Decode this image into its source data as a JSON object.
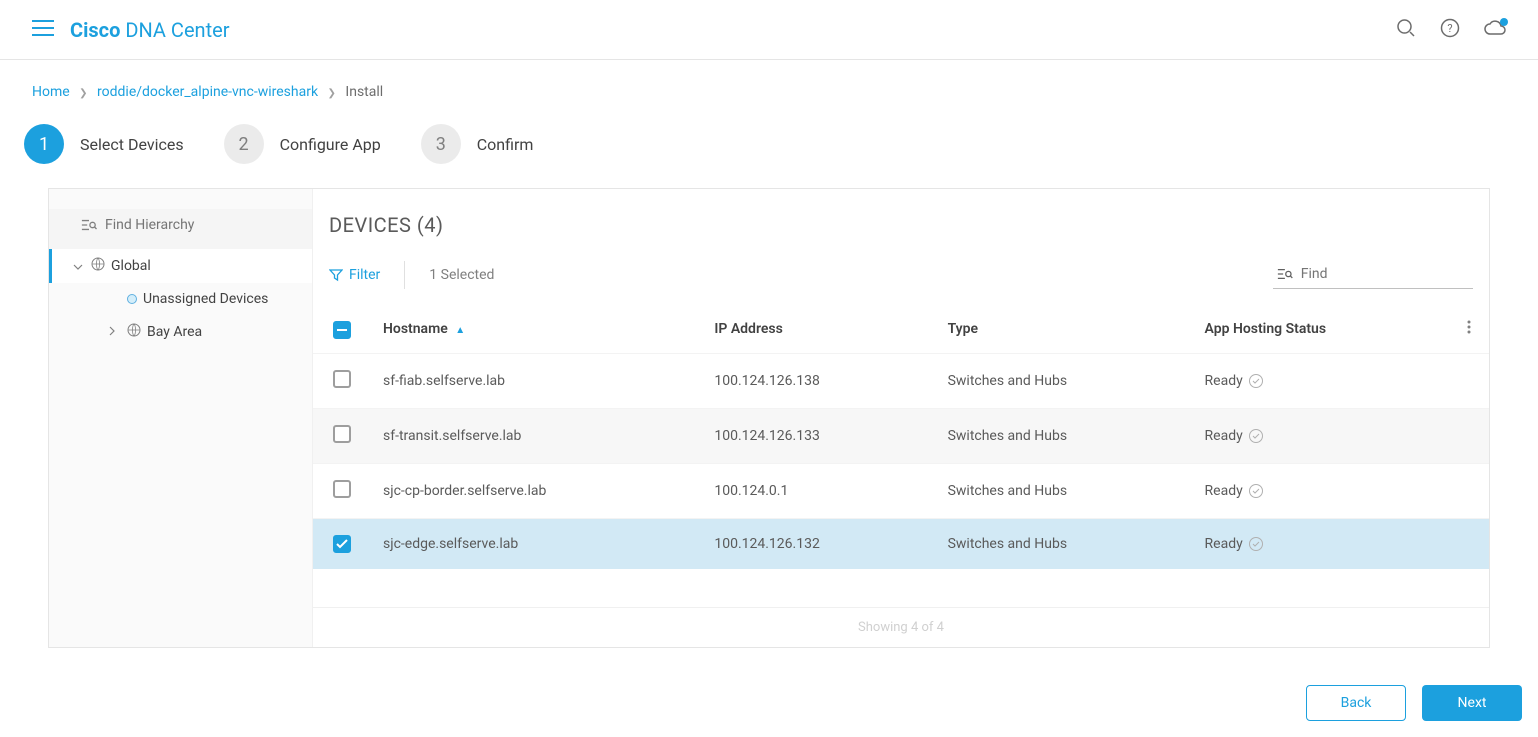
{
  "brand": {
    "cisco": "Cisco",
    "dna": "DNA Center"
  },
  "breadcrumb": {
    "home": "Home",
    "mid": "roddie/docker_alpine-vnc-wireshark",
    "current": "Install"
  },
  "stepper": {
    "s1": {
      "num": "1",
      "label": "Select Devices"
    },
    "s2": {
      "num": "2",
      "label": "Configure App"
    },
    "s3": {
      "num": "3",
      "label": "Confirm"
    }
  },
  "hierarchy": {
    "search_placeholder": "Find Hierarchy",
    "global": "Global",
    "unassigned": "Unassigned Devices",
    "bay": "Bay Area"
  },
  "devices": {
    "title": "DEVICES (4)",
    "filter_label": "Filter",
    "selected_text": "1 Selected",
    "find_placeholder": "Find",
    "cols": {
      "hostname": "Hostname",
      "ip": "IP Address",
      "type": "Type",
      "status": "App Hosting Status"
    },
    "rows": [
      {
        "hostname": "sf-fiab.selfserve.lab",
        "ip": "100.124.126.138",
        "type": "Switches and Hubs",
        "status": "Ready",
        "checked": false
      },
      {
        "hostname": "sf-transit.selfserve.lab",
        "ip": "100.124.126.133",
        "type": "Switches and Hubs",
        "status": "Ready",
        "checked": false
      },
      {
        "hostname": "sjc-cp-border.selfserve.lab",
        "ip": "100.124.0.1",
        "type": "Switches and Hubs",
        "status": "Ready",
        "checked": false
      },
      {
        "hostname": "sjc-edge.selfserve.lab",
        "ip": "100.124.126.132",
        "type": "Switches and Hubs",
        "status": "Ready",
        "checked": true
      }
    ],
    "footer": "Showing 4 of 4"
  },
  "nav": {
    "back": "Back",
    "next": "Next"
  }
}
